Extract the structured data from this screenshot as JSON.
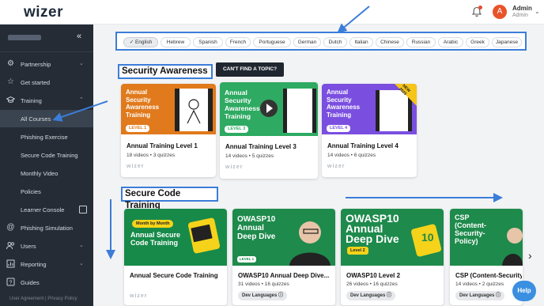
{
  "header": {
    "logo": "wizer",
    "user_name": "Admin",
    "user_role": "Admin",
    "avatar_letter": "A"
  },
  "sidebar": {
    "items": [
      {
        "label": "Partnership",
        "icon": "gear-icon",
        "chevron": "⌄"
      },
      {
        "label": "Get started",
        "icon": "star-icon"
      },
      {
        "label": "Training",
        "icon": "graduation-cap-icon",
        "chevron": "⌃"
      },
      {
        "label": "All Courses"
      },
      {
        "label": "Phishing Exercise"
      },
      {
        "label": "Secure Code Training"
      },
      {
        "label": "Monthly Video"
      },
      {
        "label": "Policies"
      },
      {
        "label": "Learner Console"
      },
      {
        "label": "Phishing Simulation",
        "icon": "at-icon"
      },
      {
        "label": "Users",
        "icon": "users-icon",
        "chevron": "⌄"
      },
      {
        "label": "Reporting",
        "icon": "chart-icon",
        "chevron": "⌄"
      },
      {
        "label": "Guides",
        "icon": "help-icon"
      }
    ],
    "footer": "User Agreement | Privacy Policy"
  },
  "languages": [
    "English",
    "Hebrew",
    "Spanish",
    "French",
    "Portuguese",
    "German",
    "Dutch",
    "Italian",
    "Chinese",
    "Russian",
    "Arabic",
    "Greek",
    "Japanese"
  ],
  "security": {
    "heading": "Security Awareness",
    "cant_find": "CAN'T FIND A TOPIC?",
    "cards": [
      {
        "thumb_title": "Annual Security Awareness Training",
        "level": "LEVEL 1",
        "title": "Annual Training Level 1",
        "meta": "18 videos  •  3 quizzes",
        "brand": "wizer",
        "color": "#e07a1c"
      },
      {
        "thumb_title": "Annual Security Awareness Training",
        "level": "LEVEL 3",
        "title": "Annual Training Level 3",
        "meta": "14 videos  •  5 quizzes",
        "brand": "wizer",
        "color": "#2eaa62"
      },
      {
        "thumb_title": "Annual Security Awareness Training",
        "level": "LEVEL 4",
        "title": "Annual Training Level 4",
        "meta": "14 videos  •  6 quizzes",
        "brand": "wizer",
        "color": "#7a4fe0",
        "ribbon": "NEW 2025"
      }
    ]
  },
  "secure_code": {
    "heading": "Secure Code Training",
    "cards": [
      {
        "pill": "Month by Month",
        "thumb_title": "Annual Secure Code Training",
        "title": "Annual Secure Code Training",
        "meta": "",
        "brand": "wizer",
        "color": "#178a4a"
      },
      {
        "thumb_title": "OWASP10 Annual Deep Dive",
        "level": "LEVEL 1",
        "title": "OWASP10 Annual Deep Dive...",
        "meta": "31 videos  •  16 quizzes",
        "tag": "Dev Languages ⓘ",
        "color": "#1e8a4c"
      },
      {
        "thumb_title": "OWASP10 Annual Deep Dive",
        "level": "Level 2",
        "title": "OWASP10 Level 2",
        "meta": "26 videos  •  16 quizzes",
        "tag": "Dev Languages ⓘ",
        "color": "#1e8a4c",
        "badge": "10"
      },
      {
        "thumb_title": "CSP (Content-Security-Policy)",
        "title": "CSP (Content-Security-",
        "meta": "14 videos  •  2 quizzes",
        "tag": "Dev Languages ⓘ",
        "color": "#1e8a4c"
      }
    ]
  },
  "help_label": "Help",
  "colors": {
    "accent": "#3b7dd8",
    "sidebar": "#252c36",
    "avatar": "#e8542a"
  }
}
